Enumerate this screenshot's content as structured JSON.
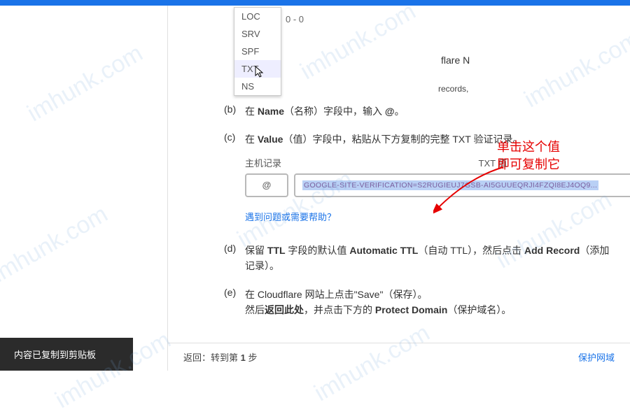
{
  "dropdown": {
    "items": [
      "LOC",
      "SRV",
      "SPF",
      "TXT",
      "NS"
    ],
    "hoverIndex": 3,
    "partial": "0 - 0"
  },
  "behind": {
    "line1": "flare N",
    "line2": "records,"
  },
  "steps": {
    "b": {
      "label": "(b)",
      "prefix": "在 ",
      "bold1": "Name",
      "mid": "（名称）字段中，输入 ",
      "bold2": "@",
      "suffix": "。"
    },
    "c": {
      "label": "(c)",
      "prefix": "在 ",
      "bold1": "Value",
      "suffix": "（值）字段中，粘贴从下方复制的完整 TXT 验证记录。"
    },
    "d": {
      "label": "(d)",
      "prefix": "保留 ",
      "bold1": "TTL",
      "mid1": " 字段的默认值 ",
      "bold2": "Automatic TTL",
      "mid2": "（自动 TTL），然后点击 ",
      "bold3": "Add Record",
      "suffix": "（添加记录）。"
    },
    "e": {
      "label": "(e)",
      "line1a": "在 Cloudflare 网站上点击\"Save\"（保存）。",
      "line2a": "然后",
      "line2bold": "返回此处",
      "line2b": "，并点击下方的 ",
      "line2bold2": "Protect Domain",
      "line2c": "（保护域名）。"
    }
  },
  "record": {
    "header_host": "主机记录",
    "header_txt": "TXT 值",
    "host_value": "@",
    "txt_value": "GOOGLE-SITE-VERIFICATION=S2RUGIEUJ7GSB-AI5GUUEQRJI4FZQI8EJ4OQ9..."
  },
  "help_link": "遇到问题或需要帮助？",
  "footer": {
    "left_prefix": "返回：转到第 ",
    "left_step": "1",
    "left_suffix": " 步",
    "right": "保护网域"
  },
  "toast": "内容已复制到剪贴板",
  "annotation": {
    "line1": "单击这个值",
    "line2": "即可复制它"
  },
  "watermark": "imhunk.com"
}
